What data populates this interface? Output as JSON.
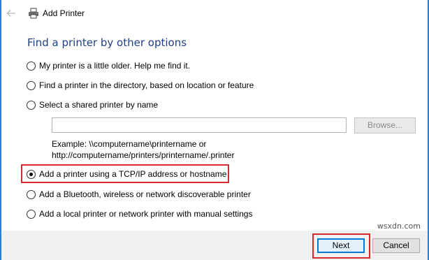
{
  "window": {
    "title": "Add Printer",
    "back_icon": "back-arrow-icon",
    "app_icon": "printer-icon",
    "accent": "#2a7fd4"
  },
  "page": {
    "heading": "Find a printer by other options",
    "heading_color": "#1e3f87"
  },
  "options": [
    {
      "label": "My printer is a little older. Help me find it.",
      "selected": false
    },
    {
      "label": "Find a printer in the directory, based on location or feature",
      "selected": false
    },
    {
      "label": "Select a shared printer by name",
      "selected": false
    },
    {
      "label": "Add a printer using a TCP/IP address or hostname",
      "selected": true
    },
    {
      "label": "Add a Bluetooth, wireless or network discoverable printer",
      "selected": false
    },
    {
      "label": "Add a local printer or network printer with manual settings",
      "selected": false
    }
  ],
  "shared_printer": {
    "input_value": "",
    "browse_label": "Browse...",
    "example_line1": "Example: \\\\computername\\printername or",
    "example_line2": "http://computername/printers/printername/.printer"
  },
  "footer": {
    "next_label": "Next",
    "cancel_label": "Cancel"
  },
  "highlight_color": "#d9272e",
  "watermark": "wsxdn.com"
}
